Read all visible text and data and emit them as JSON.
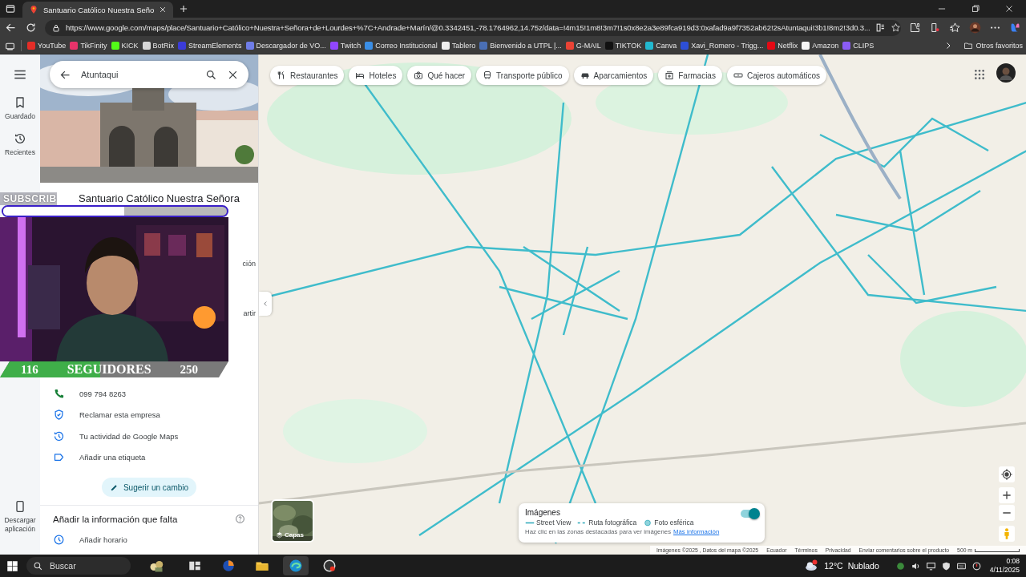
{
  "browser": {
    "tab_title": "Santuario Católico Nuestra Seño",
    "url": "https://www.google.com/maps/place/Santuario+Católico+Nuestra+Señora+de+Lourdes+%7C+Andrade+Marín/@0.3342451,-78.1764962,14.75z/data=!4m15!1m8!3m7!1s0x8e2a3e89fca919d3:0xafad9a9f7352ab62!2sAtuntaqui!3b1!8m2!3d0.3...",
    "bookmarks": [
      {
        "label": "YouTube",
        "color": "#e52d27"
      },
      {
        "label": "TikFinity",
        "color": "#e8336a"
      },
      {
        "label": "KICK",
        "color": "#53fc18"
      },
      {
        "label": "BotRix",
        "color": "#d8d8d8"
      },
      {
        "label": "StreamElements",
        "color": "#3b3bd8"
      },
      {
        "label": "Descargador de VO...",
        "color": "#6f7de8"
      },
      {
        "label": "Twitch",
        "color": "#9146ff"
      },
      {
        "label": "Correo Institucional",
        "color": "#3a8ee6"
      },
      {
        "label": "Tablero",
        "color": "#eeeeee"
      },
      {
        "label": "Bienvenido a UTPL |...",
        "color": "#4a6fb5"
      },
      {
        "label": "G-MAIL",
        "color": "#ea4335"
      },
      {
        "label": "TIKTOK",
        "color": "#111111"
      },
      {
        "label": "Canva",
        "color": "#22b8cf"
      },
      {
        "label": "Xavi_Romero - Trigg...",
        "color": "#2d4fd6"
      },
      {
        "label": "Netflix",
        "color": "#e50914"
      },
      {
        "label": "Amazon",
        "color": "#f5f5f5"
      },
      {
        "label": "CLIPS",
        "color": "#8b5cf6"
      }
    ],
    "other_bookmarks": "Otros favoritos"
  },
  "rail": {
    "items": [
      {
        "kind": "saved",
        "label": "Guardado"
      },
      {
        "kind": "recent",
        "label": "Recientes"
      }
    ],
    "download": "Descargar aplicación"
  },
  "search": {
    "value": "Atuntaqui"
  },
  "place": {
    "title": "Santuario Católico Nuestra Señora",
    "hidden_fragments": [
      "ción",
      "artir"
    ],
    "details": [
      {
        "kind": "phone",
        "text": "099 794 8263"
      },
      {
        "kind": "claim",
        "text": "Reclamar esta empresa"
      },
      {
        "kind": "activity",
        "text": "Tu actividad de Google Maps"
      },
      {
        "kind": "label",
        "text": "Añadir una etiqueta"
      }
    ],
    "suggest_button": "Sugerir un cambio",
    "missing": {
      "title": "Añadir la información que falta",
      "items": [
        {
          "kind": "hours",
          "text": "Añadir horario"
        }
      ]
    }
  },
  "stream_overlay": {
    "subscribers": {
      "label": "SUBSCRIB",
      "level": 0.54
    },
    "followers": {
      "current": "116",
      "label": "SEGUIDORES",
      "goal": "250",
      "level": 0.44
    }
  },
  "map": {
    "chips": [
      {
        "kind": "restaurant",
        "label": "Restaurantes"
      },
      {
        "kind": "hotel",
        "label": "Hoteles"
      },
      {
        "kind": "activities",
        "label": "Qué hacer"
      },
      {
        "kind": "transit",
        "label": "Transporte público"
      },
      {
        "kind": "parking",
        "label": "Aparcamientos"
      },
      {
        "kind": "pharmacy",
        "label": "Farmacias"
      },
      {
        "kind": "atm",
        "label": "Cajeros automáticos"
      }
    ],
    "layers_label": "Capas",
    "images_card": {
      "title": "Imágenes",
      "on": true,
      "legend": [
        {
          "kind": "line",
          "label": "Street View"
        },
        {
          "kind": "dashed",
          "label": "Ruta fotográfica"
        },
        {
          "kind": "dot",
          "label": "Foto esférica"
        }
      ],
      "hint": "Haz clic en las zonas destacadas para ver imágenes",
      "link": "Más información"
    },
    "footer": [
      {
        "kind": "text",
        "label": "Imágenes ©2025 , Datos del mapa ©2025"
      },
      {
        "kind": "link",
        "label": "Ecuador"
      },
      {
        "kind": "link",
        "label": "Términos"
      },
      {
        "kind": "link",
        "label": "Privacidad"
      },
      {
        "kind": "link",
        "label": "Enviar comentarios sobre el producto"
      },
      {
        "kind": "scale",
        "label": "500 m"
      }
    ]
  },
  "taskbar": {
    "search_placeholder": "Buscar",
    "temperature": "12°C",
    "condition": "Nublado",
    "time": "0:08",
    "date": "4/11/2025"
  }
}
